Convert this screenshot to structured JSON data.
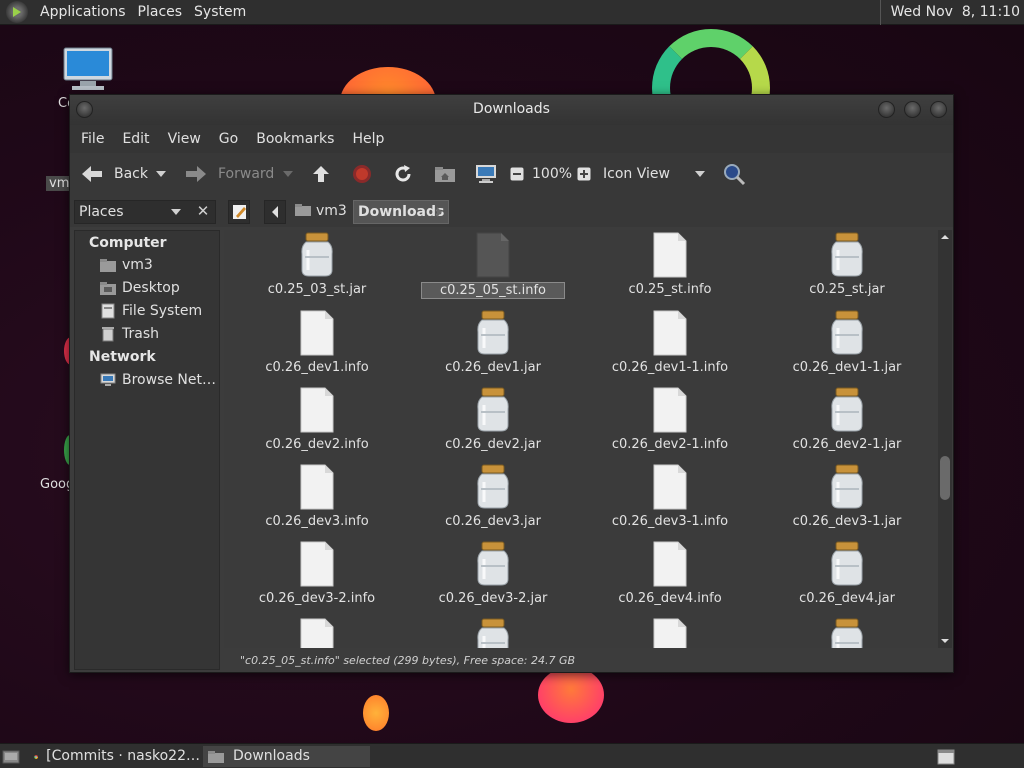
{
  "top_panel": {
    "menus": [
      "Applications",
      "Places",
      "System"
    ],
    "clock": "Wed Nov  8, 11:10"
  },
  "desktop": {
    "icons": [
      {
        "label": "Co",
        "icon": "computer-icon"
      },
      {
        "label": "vm",
        "icon": "home-folder-icon"
      },
      {
        "label": "Goog",
        "icon": "chrome-icon"
      }
    ]
  },
  "window": {
    "title": "Downloads",
    "menus": [
      "File",
      "Edit",
      "View",
      "Go",
      "Bookmarks",
      "Help"
    ],
    "toolbar": {
      "back": "Back",
      "forward": "Forward",
      "zoom": "100%",
      "view_mode": "Icon View"
    },
    "places_label": "Places",
    "breadcrumbs": [
      "vm3",
      "Downloads"
    ],
    "sidebar": {
      "computer_header": "Computer",
      "computer_items": [
        "vm3",
        "Desktop",
        "File System",
        "Trash"
      ],
      "network_header": "Network",
      "network_items": [
        "Browse Net…"
      ]
    },
    "files": [
      {
        "name": "c0.25_03_st.jar",
        "type": "jar"
      },
      {
        "name": "c0.25_05_st.info",
        "type": "info-selected"
      },
      {
        "name": "c0.25_st.info",
        "type": "info"
      },
      {
        "name": "c0.25_st.jar",
        "type": "jar"
      },
      {
        "name": "c0.26_dev1.info",
        "type": "info"
      },
      {
        "name": "c0.26_dev1.jar",
        "type": "jar"
      },
      {
        "name": "c0.26_dev1-1.info",
        "type": "info"
      },
      {
        "name": "c0.26_dev1-1.jar",
        "type": "jar"
      },
      {
        "name": "c0.26_dev2.info",
        "type": "info"
      },
      {
        "name": "c0.26_dev2.jar",
        "type": "jar"
      },
      {
        "name": "c0.26_dev2-1.info",
        "type": "info"
      },
      {
        "name": "c0.26_dev2-1.jar",
        "type": "jar"
      },
      {
        "name": "c0.26_dev3.info",
        "type": "info"
      },
      {
        "name": "c0.26_dev3.jar",
        "type": "jar"
      },
      {
        "name": "c0.26_dev3-1.info",
        "type": "info"
      },
      {
        "name": "c0.26_dev3-1.jar",
        "type": "jar"
      },
      {
        "name": "c0.26_dev3-2.info",
        "type": "info"
      },
      {
        "name": "c0.26_dev3-2.jar",
        "type": "jar"
      },
      {
        "name": "c0.26_dev4.info",
        "type": "info"
      },
      {
        "name": "c0.26_dev4.jar",
        "type": "jar"
      }
    ],
    "status": "\"c0.25_05_st.info\" selected (299 bytes), Free space: 24.7 GB"
  },
  "taskbar": {
    "tasks": [
      "[Commits · nasko22…",
      "Downloads"
    ]
  },
  "colors": {
    "panel": "#2f2f2f",
    "window_bg": "#3c3c3c",
    "stop_red": "#c0392b",
    "wallpaper": "#1f0818"
  }
}
